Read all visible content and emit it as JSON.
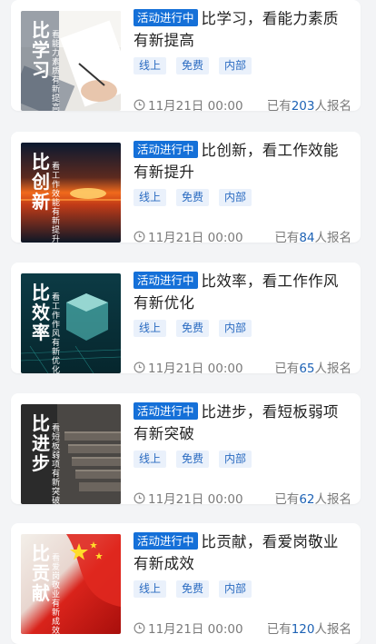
{
  "colors": {
    "status_bg": "#1570d8",
    "tag_bg": "#eaf1fb",
    "tag_text": "#2a6bc1",
    "count": "#1d62b5"
  },
  "activities": [
    {
      "status": "活动进行中",
      "title": "比学习，看能力素质有新提高",
      "tags": [
        "线上",
        "免费",
        "内部"
      ],
      "date": "11月21日 00:00",
      "signup_prefix": "已有",
      "count": "203",
      "signup_suffix": "人报名",
      "poster_title": "比学习",
      "poster_subtitle": "看能力素质有新提高"
    },
    {
      "status": "活动进行中",
      "title": "比创新，看工作效能有新提升",
      "tags": [
        "线上",
        "免费",
        "内部"
      ],
      "date": "11月21日 00:00",
      "signup_prefix": "已有",
      "count": "84",
      "signup_suffix": "人报名",
      "poster_title": "比创新",
      "poster_subtitle": "看工作效能有新提升"
    },
    {
      "status": "活动进行中",
      "title": "比效率，看工作作风有新优化",
      "tags": [
        "线上",
        "免费",
        "内部"
      ],
      "date": "11月21日 00:00",
      "signup_prefix": "已有",
      "count": "65",
      "signup_suffix": "人报名",
      "poster_title": "比效率",
      "poster_subtitle": "看工作作风有新优化"
    },
    {
      "status": "活动进行中",
      "title": "比进步，看短板弱项有新突破",
      "tags": [
        "线上",
        "免费",
        "内部"
      ],
      "date": "11月21日 00:00",
      "signup_prefix": "已有",
      "count": "62",
      "signup_suffix": "人报名",
      "poster_title": "比进步",
      "poster_subtitle": "看短板弱项有新突破"
    },
    {
      "status": "活动进行中",
      "title": "比贡献，看爱岗敬业有新成效",
      "tags": [
        "线上",
        "免费",
        "内部"
      ],
      "date": "11月21日 00:00",
      "signup_prefix": "已有",
      "count": "120",
      "signup_suffix": "人报名",
      "poster_title": "比贡献",
      "poster_subtitle": "看爱岗敬业有新成效"
    }
  ]
}
